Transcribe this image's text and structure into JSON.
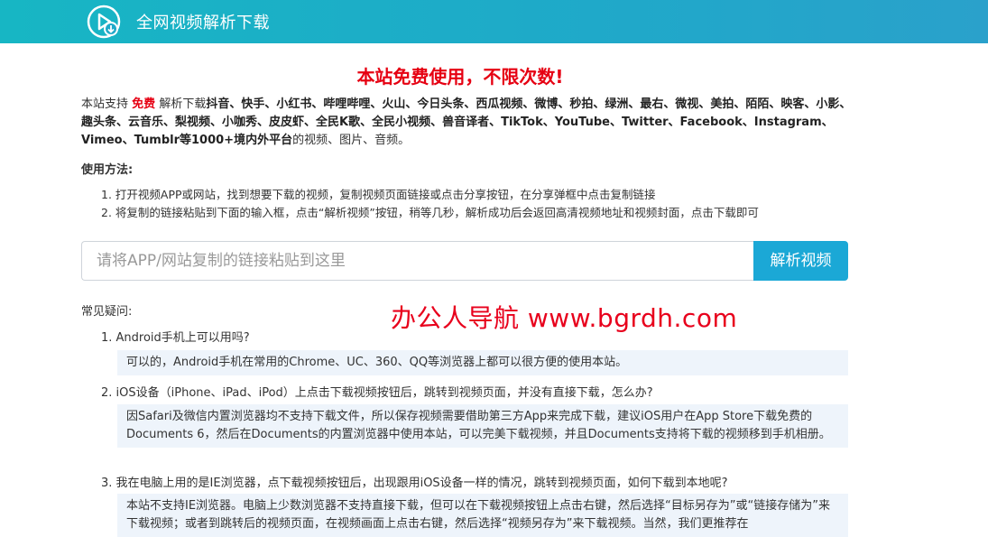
{
  "header": {
    "title": "全网视频解析下载",
    "logo_icon": "video-download-icon"
  },
  "headline": "本站免费使用，不限次数!",
  "intro": {
    "prefix": "本站支持",
    "free": "免费",
    "middle": "解析下载",
    "platforms": "抖音、快手、小红书、哔哩哔哩、火山、今日头条、西瓜视频、微博、秒拍、绿洲、最右、微视、美拍、陌陌、映客、小影、趣头条、云音乐、梨视频、小咖秀、皮皮虾、全民K歌、全民小视频、兽音译者、TikTok、YouTube、Twitter、Facebook、Instagram、Vimeo、Tumblr等1000+境内外平台",
    "suffix": "的视频、图片、音频。"
  },
  "usage": {
    "title": "使用方法:",
    "steps": [
      "1. 打开视频APP或网站，找到想要下载的视频，复制视频页面链接或点击分享按钮，在分享弹框中点击复制链接",
      "2. 将复制的链接粘贴到下面的输入框，点击“解析视频”按钮，稍等几秒，解析成功后会返回高清视频地址和视频封面，点击下载即可"
    ]
  },
  "search": {
    "placeholder": "请将APP/网站复制的链接粘贴到这里",
    "button_label": "解析视频"
  },
  "faq": {
    "title": "常见疑问:",
    "watermark": "办公人导航  www.bgrdh.com",
    "items": [
      {
        "q": "1. Android手机上可以用吗?",
        "a": "可以的，Android手机在常用的Chrome、UC、360、QQ等浏览器上都可以很方便的使用本站。"
      },
      {
        "q": "2. iOS设备（iPhone、iPad、iPod）上点击下载视频按钮后，跳转到视频页面，并没有直接下载，怎么办?",
        "a": "因Safari及微信内置浏览器均不支持下载文件，所以保存视频需要借助第三方App来完成下载，建议iOS用户在App Store下载免费的Documents 6，然后在Documents的内置浏览器中使用本站，可以完美下载视频，并且Documents支持将下载的视频移到手机相册。"
      },
      {
        "q": "3. 我在电脑上用的是IE浏览器，点下载视频按钮后，出现跟用iOS设备一样的情况，跳转到视频页面，如何下载到本地呢?",
        "a": "本站不支持IE浏览器。电脑上少数浏览器不支持直接下载，但可以在下载视频按钮上点击右键，然后选择“目标另存为”或“链接存储为”来下载视频；或者到跳转后的视频页面，在视频画面上点击右键，然后选择“视频另存为”来下载视频。当然，我们更推荐在"
      }
    ]
  }
}
